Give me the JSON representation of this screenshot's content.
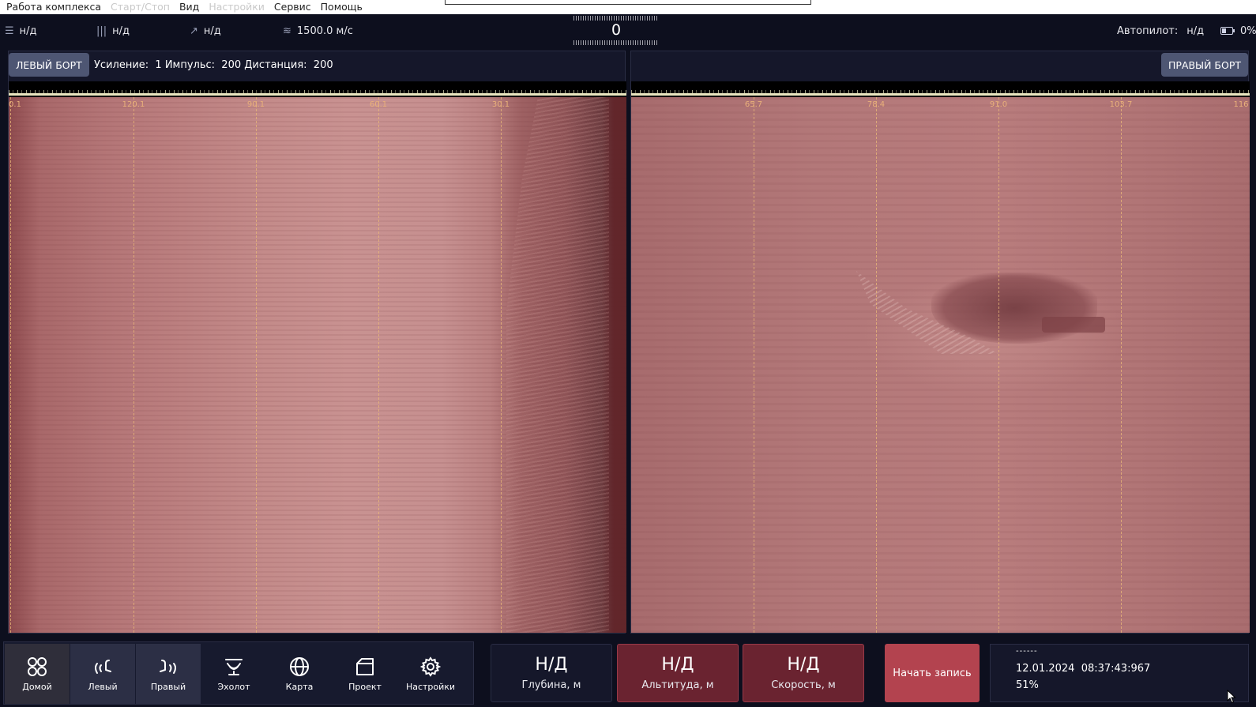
{
  "menu": {
    "items": [
      {
        "label": "Работа комплекса",
        "enabled": true
      },
      {
        "label": "Старт/Стоп",
        "enabled": false
      },
      {
        "label": "Вид",
        "enabled": true
      },
      {
        "label": "Настройки",
        "enabled": false
      },
      {
        "label": "Сервис",
        "enabled": true
      },
      {
        "label": "Помощь",
        "enabled": true
      }
    ]
  },
  "status": {
    "heading": "н/д",
    "depth": "н/д",
    "course": "н/д",
    "sound_speed": "1500.0 м/с",
    "compass_value": "0",
    "autopilot_label": "Автопилот:",
    "autopilot_value": "н/д",
    "battery": "0%"
  },
  "left_panel": {
    "button": "ЛЕВЫЙ БОРТ",
    "info": "Усиление:  1 Импульс:  200 Дистанция:  200",
    "scale": [
      "0.1",
      "120.1",
      "90.1",
      "60.1",
      "30.1"
    ]
  },
  "right_panel": {
    "button": "ПРАВЫЙ БОРТ",
    "scale": [
      "65.7",
      "78.4",
      "91.0",
      "103.7",
      "116"
    ]
  },
  "nav": [
    {
      "label": "Домой",
      "icon": "home-grid-icon"
    },
    {
      "label": "Левый",
      "icon": "left-sonar-icon"
    },
    {
      "label": "Правый",
      "icon": "right-sonar-icon"
    },
    {
      "label": "Эхолот",
      "icon": "echosounder-icon"
    },
    {
      "label": "Карта",
      "icon": "globe-icon"
    },
    {
      "label": "Проект",
      "icon": "folder-icon"
    },
    {
      "label": "Настройки",
      "icon": "gear-icon"
    }
  ],
  "metrics": [
    {
      "value": "Н/Д",
      "caption": "Глубина, м"
    },
    {
      "value": "Н/Д",
      "caption": "Альтитуда, м"
    },
    {
      "value": "Н/Д",
      "caption": "Скорость, м"
    }
  ],
  "record_button": "Начать запись",
  "info": {
    "dashes": "------",
    "datetime": "12.01.2024  08:37:43:967",
    "percent": "51%"
  },
  "colors": {
    "background": "#0d0f1e",
    "alert": "#6a2330",
    "record": "#b3434f",
    "scale_label": "#e9b07a"
  }
}
